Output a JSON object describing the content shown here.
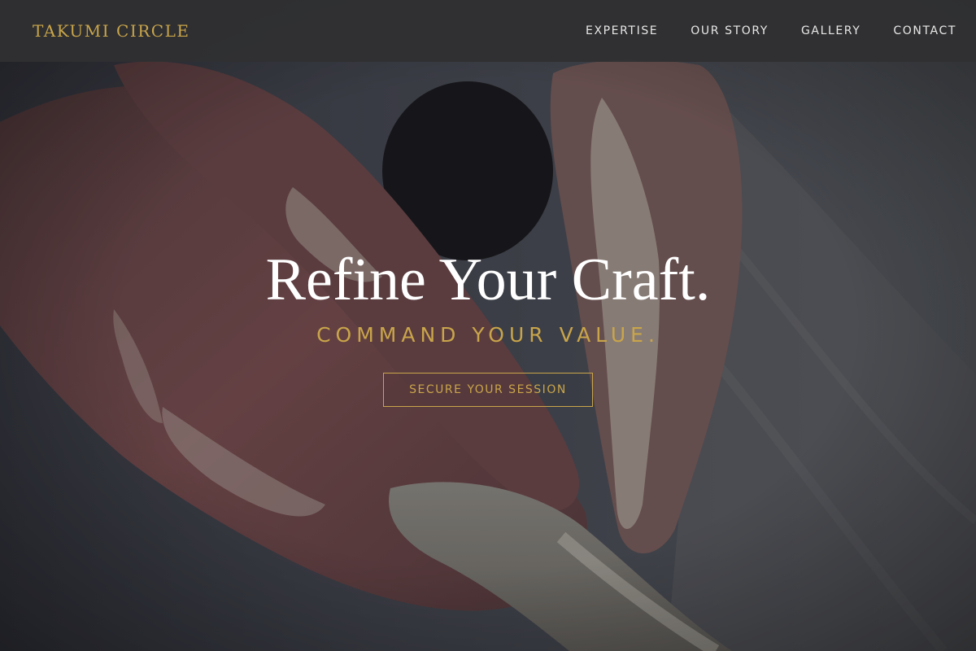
{
  "brand": {
    "name": "TAKUMI CIRCLE"
  },
  "nav": {
    "items": [
      {
        "label": "EXPERTISE"
      },
      {
        "label": "OUR STORY"
      },
      {
        "label": "GALLERY"
      },
      {
        "label": "CONTACT"
      }
    ]
  },
  "hero": {
    "title": "Refine Your Craft.",
    "subtitle": "COMMAND YOUR VALUE.",
    "cta_label": "SECURE YOUR SESSION",
    "background_image": "hands-shaping-clay-photo"
  },
  "colors": {
    "accent_gold": "#c9a54a",
    "nav_bg": "#303032",
    "title_white": "#ffffff"
  }
}
